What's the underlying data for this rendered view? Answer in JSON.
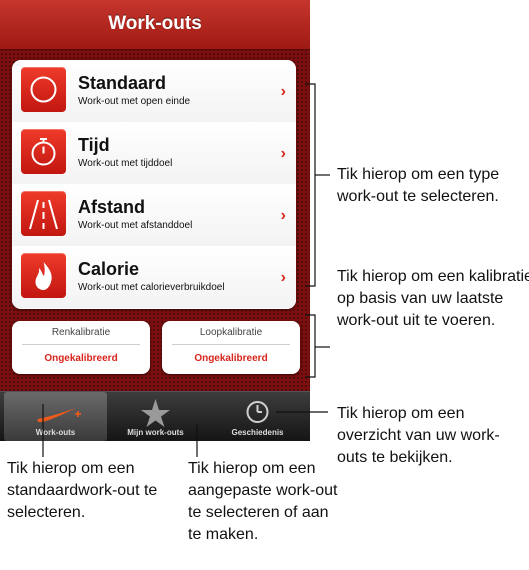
{
  "nav": {
    "title": "Work-outs"
  },
  "workouts": [
    {
      "title": "Standaard",
      "subtitle": "Work-out met open einde",
      "icon": "circle-icon"
    },
    {
      "title": "Tijd",
      "subtitle": "Work-out met tijddoel",
      "icon": "stopwatch-icon"
    },
    {
      "title": "Afstand",
      "subtitle": "Work-out met afstanddoel",
      "icon": "road-icon"
    },
    {
      "title": "Calorie",
      "subtitle": "Work-out met calorieverbruikdoel",
      "icon": "flame-icon"
    }
  ],
  "chevron": "›",
  "calibration": {
    "run": {
      "label": "Renkalibratie",
      "status": "Ongekalibreerd"
    },
    "walk": {
      "label": "Loopkalibratie",
      "status": "Ongekalibreerd"
    }
  },
  "tabs": [
    {
      "label": "Work-outs",
      "icon": "nike-swoosh-plus-icon",
      "selected": true
    },
    {
      "label": "Mijn work-outs",
      "icon": "star-icon",
      "selected": false
    },
    {
      "label": "Geschiedenis",
      "icon": "clock-icon",
      "selected": false
    }
  ],
  "callouts": {
    "workout_type": "Tik hierop om een type work-out te selecteren.",
    "calibration": "Tik hierop om een kalibratie op basis van uw laatste work-out uit te voeren.",
    "history": "Tik hierop om een overzicht van uw work-outs te bekijken.",
    "standard": "Tik hierop om een standaardwork-out te selecteren.",
    "custom": "Tik hierop om een aangepaste work-out te selecteren of aan te maken."
  },
  "colors": {
    "accent": "#d8251c",
    "background": "#7c0f0f",
    "navbar": "#b3261d"
  }
}
